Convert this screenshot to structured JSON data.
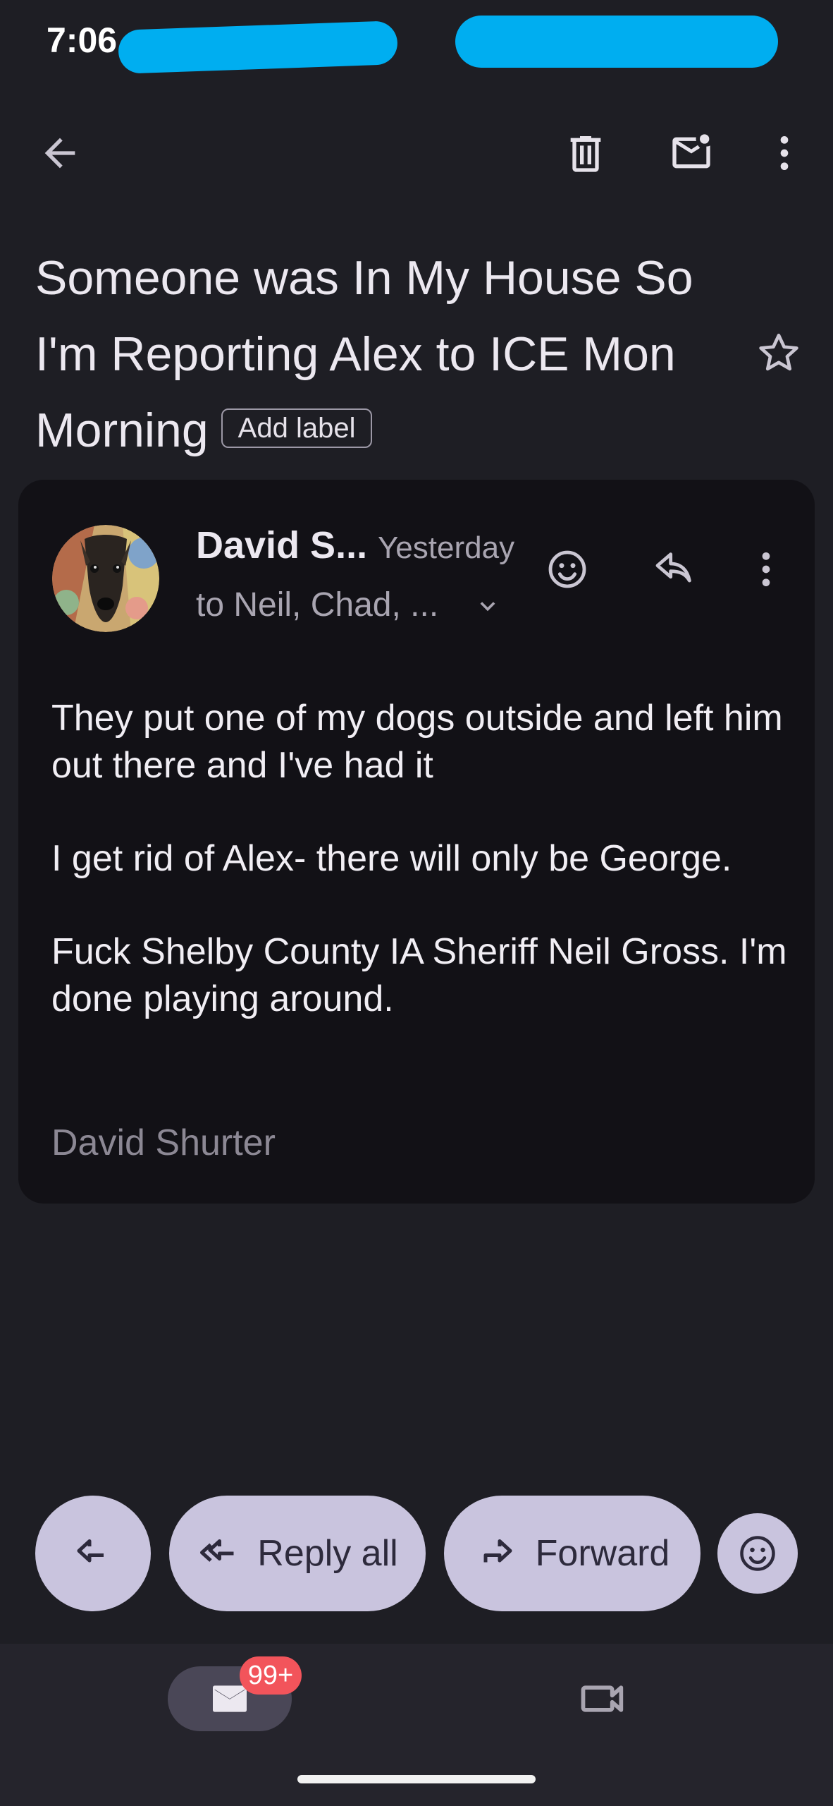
{
  "status_bar": {
    "time": "7:06"
  },
  "toolbar": {
    "back_icon": "arrow-back-icon",
    "delete_icon": "delete-icon",
    "mark_unread_icon": "mark-unread-icon",
    "more_icon": "more-vert-icon"
  },
  "email": {
    "subject": "Someone was In My House So I'm Reporting Alex to ICE Mon Morning",
    "add_label": "Add label",
    "starred": false,
    "sender": "David S...",
    "date": "Yesterday",
    "recipients": "to Neil, Chad, ...",
    "body": [
      "They put one of my dogs outside and left him out there and I've had it",
      "I get rid of Alex- there will only be George.",
      "Fuck Shelby County IA Sheriff Neil Gross.  I'm done playing around."
    ],
    "signature": "David Shurter"
  },
  "actions": {
    "reply_all": "Reply all",
    "forward": "Forward"
  },
  "bottom_nav": {
    "mail_badge": "99+"
  },
  "colors": {
    "background": "#1e1e24",
    "card": "#121116",
    "pill": "#c9c4de",
    "badge": "#f2545b",
    "redaction": "#00aef0"
  }
}
